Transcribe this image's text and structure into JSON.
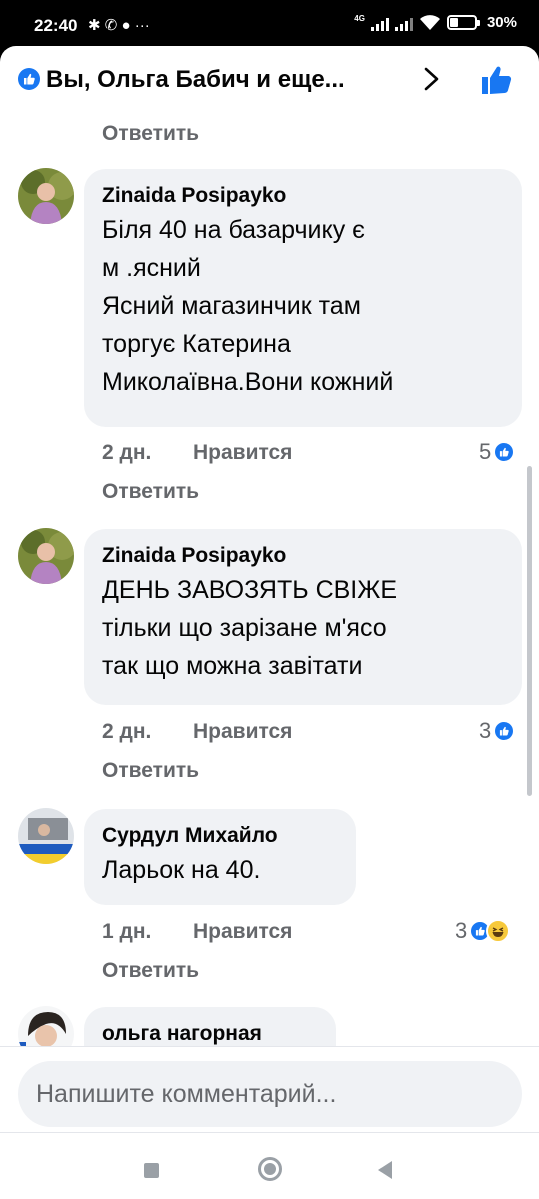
{
  "status_bar": {
    "time": "22:40",
    "left_icons": "✱ ✆ ● ···",
    "network": "4G",
    "battery": "30%"
  },
  "header": {
    "title": "Вы, Ольга Бабич и еще..."
  },
  "top_reply": "Ответить",
  "comments": [
    {
      "author": "Zinaida Posipayko",
      "text": "Біля  40 на базарчику є\nм .ясний\nЯсний  магазинчик там\nторгує Катерина\nМиколаївна.Вони кожний",
      "time": "2 дн.",
      "like_label": "Нравится",
      "reaction_count": "5",
      "reply_label": "Ответить"
    },
    {
      "author": "Zinaida Posipayko",
      "text": "ДЕНЬ ЗАВОЗЯТЬ СВІЖЕ\nтільки що зарізане м'ясо\nтак  що  можна завітати",
      "time": "2 дн.",
      "like_label": "Нравится",
      "reaction_count": "3",
      "reply_label": "Ответить"
    },
    {
      "author": "Сурдул Михайло",
      "text": "Ларьок на 40.",
      "time": "1 дн.",
      "like_label": "Нравится",
      "reaction_count": "3",
      "reply_label": "Ответить"
    },
    {
      "author": "ольга нагорная",
      "text": ""
    }
  ],
  "composer": {
    "placeholder": "Напишите комментарий..."
  },
  "colors": {
    "accent": "#1877f2",
    "bubble": "#f0f2f5",
    "secondary_text": "#65676b"
  }
}
